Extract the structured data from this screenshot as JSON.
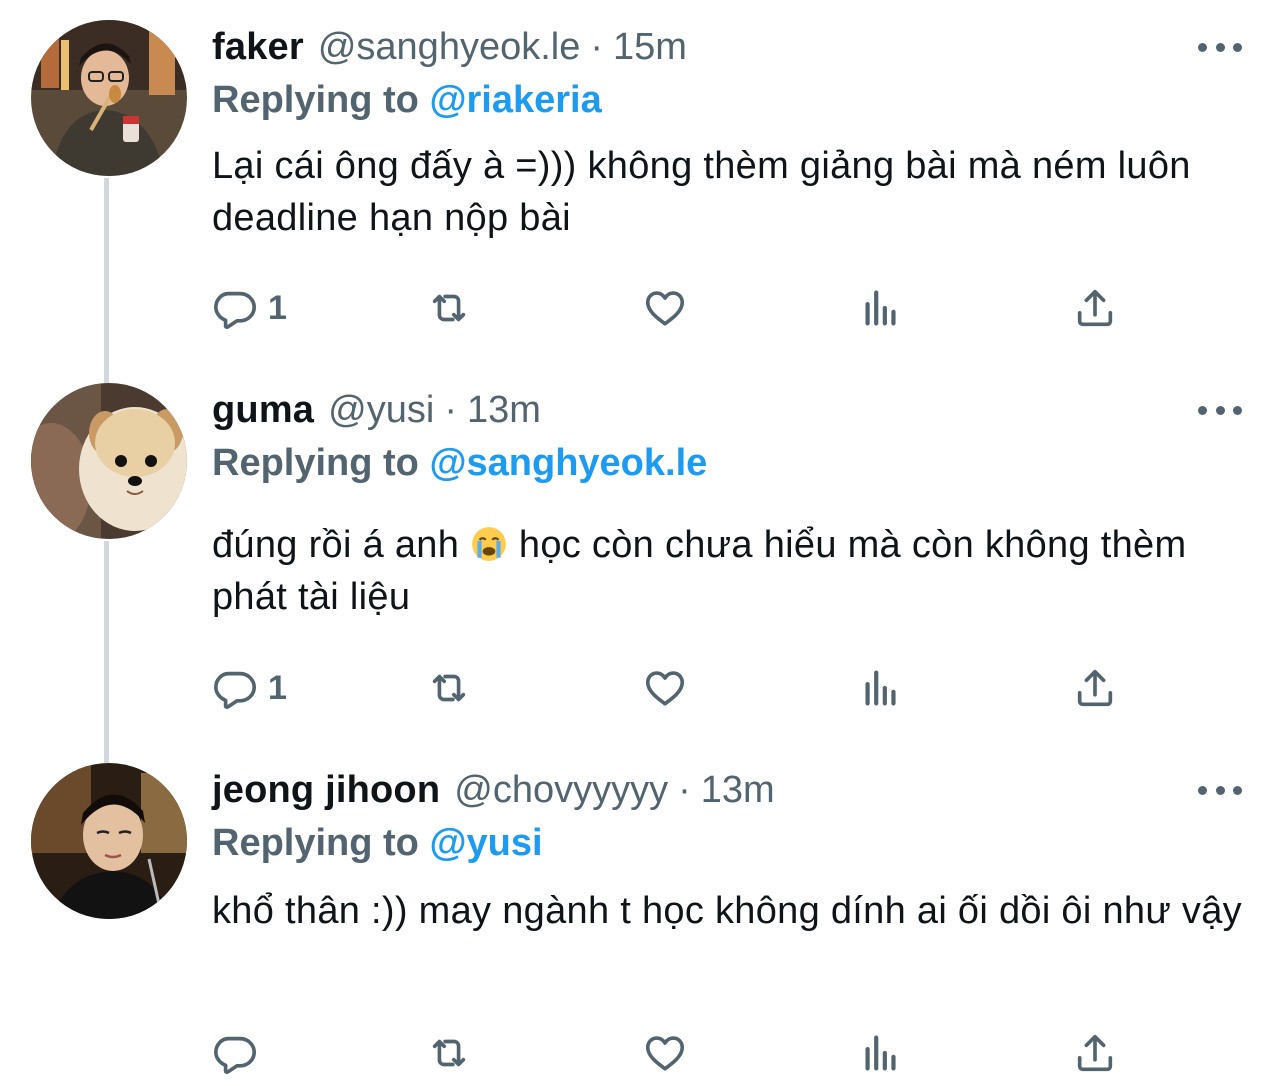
{
  "tweets": [
    {
      "name": "faker",
      "handle": "@sanghyeok.le",
      "separator": "·",
      "time": "15m",
      "replying_prefix": "Replying to",
      "replying_to": "@riakeria",
      "text": "Lại cái ông đấy à =))) không thèm giảng bài mà ném luôn deadline hạn nộp bài",
      "reply_count": "1"
    },
    {
      "name": "guma",
      "handle": "@yusi",
      "separator": "·",
      "time": "13m",
      "replying_prefix": "Replying to",
      "replying_to": "@sanghyeok.le",
      "text_before_emoji": "đúng rồi á anh ",
      "emoji": "loudly-crying-face",
      "text_after_emoji": " học còn chưa hiểu mà còn không thèm phát tài liệu",
      "reply_count": "1"
    },
    {
      "name": "jeong jihoon",
      "handle": "@chovyyyyy",
      "separator": "·",
      "time": "13m",
      "replying_prefix": "Replying to",
      "replying_to": "@yusi",
      "text": "khổ thân :)) may ngành t học không dính ai ối dồi ôi như vậy",
      "reply_count": ""
    }
  ],
  "icons": {
    "reply": "reply-icon",
    "retweet": "retweet-icon",
    "like": "heart-icon",
    "analytics": "analytics-icon",
    "share": "share-icon",
    "more": "more-icon"
  },
  "colors": {
    "text": "#0f1419",
    "secondary": "#536471",
    "link": "#1d9bf0",
    "thread_line": "#cfd9de"
  }
}
